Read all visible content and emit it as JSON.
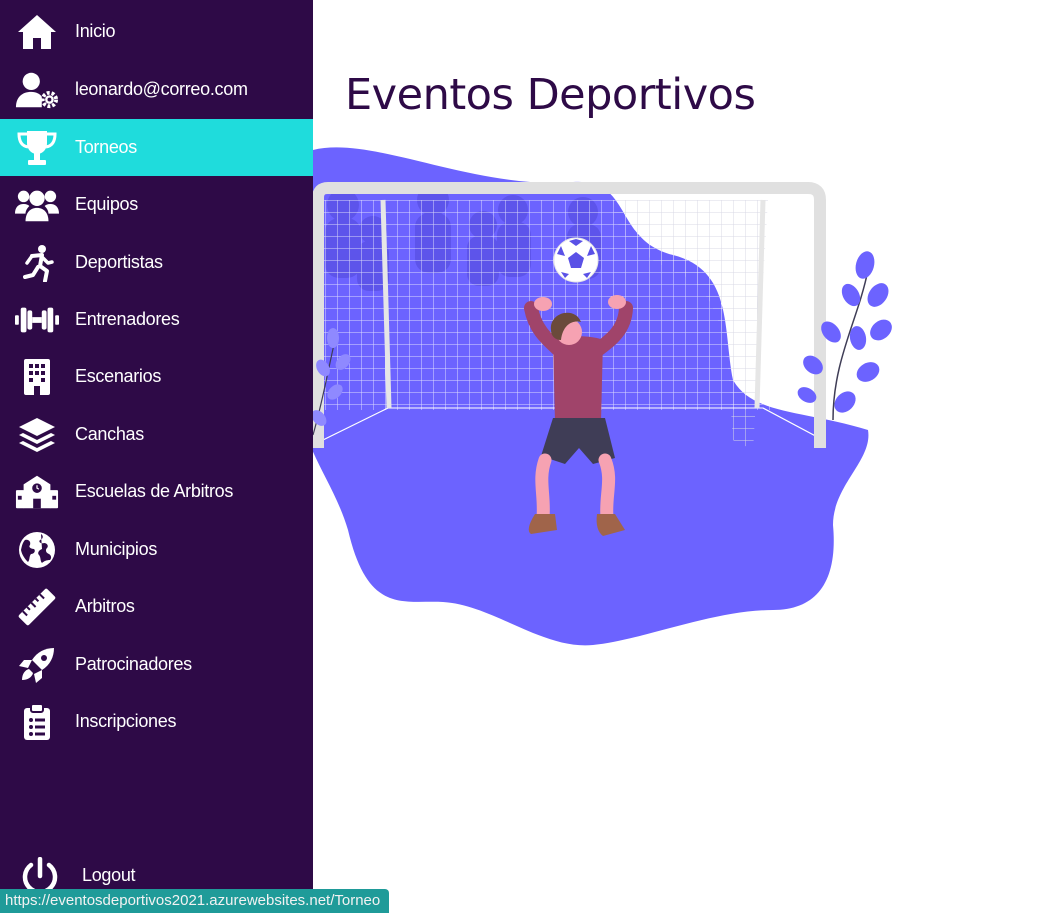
{
  "sidebar": {
    "items": [
      {
        "label": "Inicio",
        "icon": "home-icon"
      },
      {
        "label": "leonardo@correo.com",
        "icon": "user-cog-icon"
      },
      {
        "label": "Torneos",
        "icon": "trophy-icon",
        "active": true
      },
      {
        "label": "Equipos",
        "icon": "users-icon"
      },
      {
        "label": "Deportistas",
        "icon": "running-icon"
      },
      {
        "label": "Entrenadores",
        "icon": "dumbbell-icon"
      },
      {
        "label": "Escenarios",
        "icon": "building-icon"
      },
      {
        "label": "Canchas",
        "icon": "layers-icon"
      },
      {
        "label": "Escuelas de Arbitros",
        "icon": "school-icon"
      },
      {
        "label": "Municipios",
        "icon": "globe-icon"
      },
      {
        "label": "Arbitros",
        "icon": "ruler-icon"
      },
      {
        "label": "Patrocinadores",
        "icon": "rocket-icon"
      },
      {
        "label": "Inscripciones",
        "icon": "clipboard-list-icon"
      }
    ],
    "logout_label": "Logout"
  },
  "main": {
    "title": "Eventos Deportivos"
  },
  "status_bar": {
    "url": "https://eventosdeportivos2021.azurewebsites.net/Torneo"
  },
  "colors": {
    "sidebar_bg": "#2e0a47",
    "active_bg": "#1fdcdc",
    "accent_purple": "#6c63ff",
    "title_color": "#2e0a47"
  }
}
